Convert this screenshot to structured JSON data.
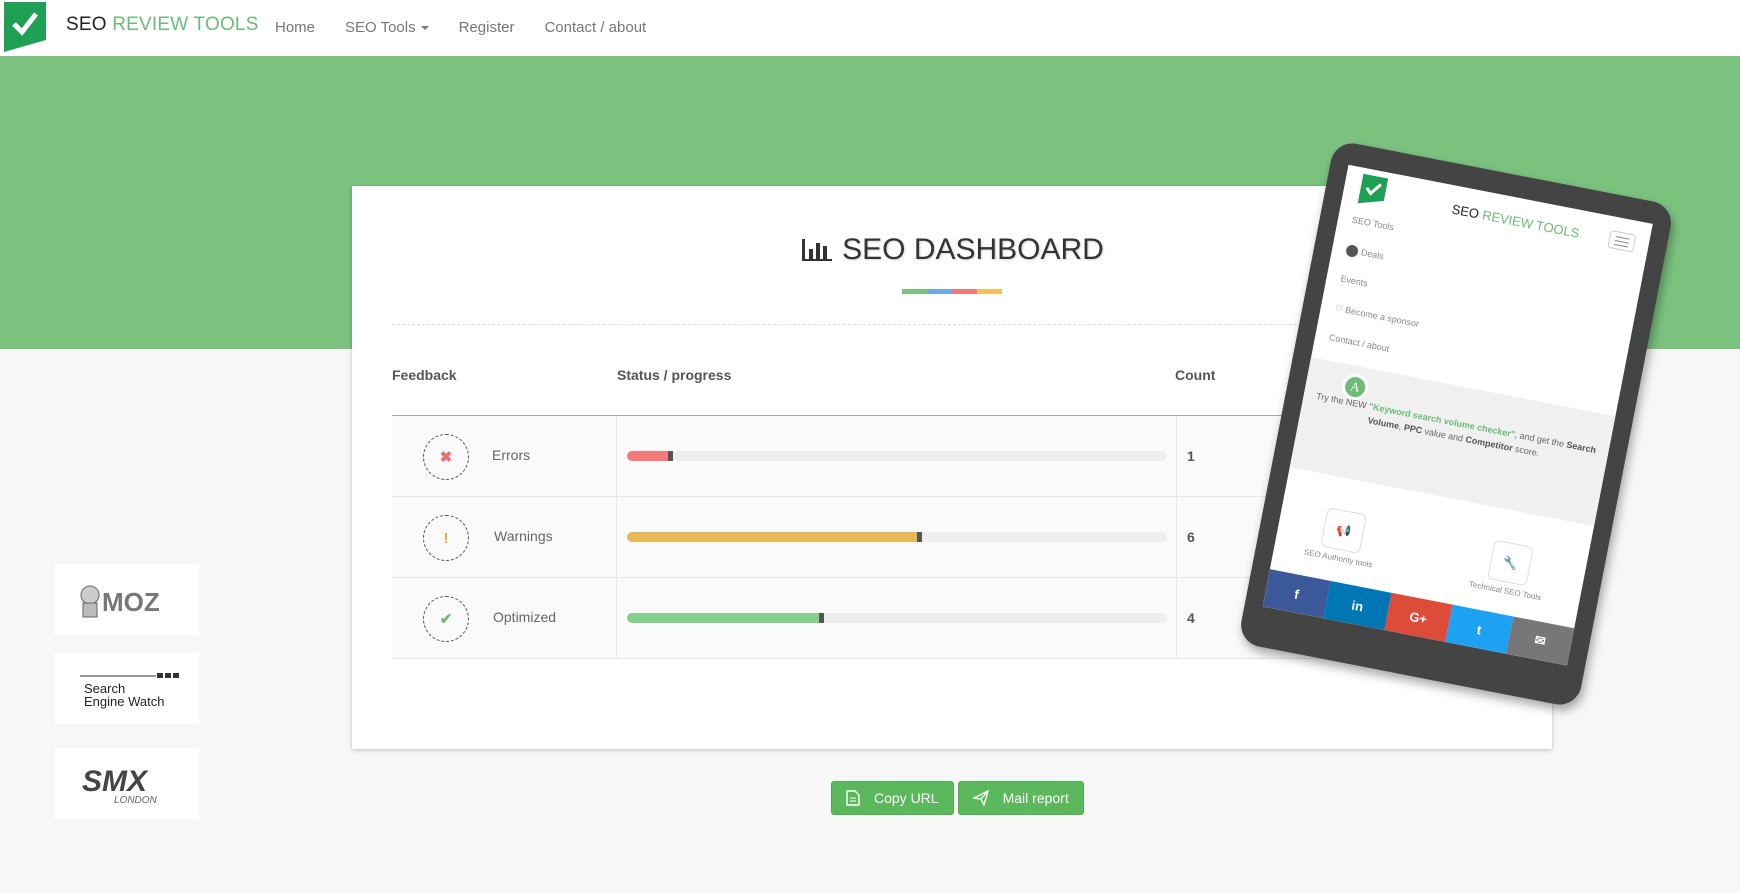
{
  "nav": {
    "brand_prefix": "SEO",
    "brand_accent": "REVIEW TOOLS",
    "links": [
      "Home",
      "SEO Tools",
      "Register",
      "Contact / about"
    ]
  },
  "dashboard": {
    "title": "SEO DASHBOARD",
    "headers": {
      "feedback": "Feedback",
      "status": "Status / progress",
      "count": "Count"
    },
    "rows": [
      {
        "label": "Errors",
        "count": "1",
        "progress": 0.08,
        "color": "#f47a7a",
        "icon_name": "x-icon",
        "icon_color": "#e9706f"
      },
      {
        "label": "Warnings",
        "count": "6",
        "progress": 0.54,
        "color": "#e8b95a",
        "icon_name": "exclamation-icon",
        "icon_color": "#e0aa3e"
      },
      {
        "label": "Optimized",
        "count": "4",
        "progress": 0.36,
        "color": "#85d08d",
        "icon_name": "check-icon",
        "icon_color": "#6cbb78"
      }
    ],
    "stripe_colors": [
      "#7bc27f",
      "#6fa8dc",
      "#f07a7a",
      "#f1c15e"
    ]
  },
  "buttons": {
    "copy_url": "Copy URL",
    "mail_report": "Mail report"
  },
  "sponsors": [
    "MOZ",
    "Search Engine Watch",
    "SMX LONDON"
  ],
  "phone": {
    "brand_prefix": "SEO",
    "brand_accent": "REVIEW TOOLS",
    "menu": [
      "SEO Tools",
      "Deals",
      "Events",
      "Become a sponsor",
      "Contact / about"
    ],
    "promo_intro": "Try the NEW",
    "promo_link": "\"Keyword search volume checker\"",
    "promo_rest1": ", and get the",
    "promo_bold1": "Search Volume",
    "promo_sep": ",",
    "promo_bold2": "PPC",
    "promo_rest2": "value and",
    "promo_bold3": "Competitor",
    "promo_rest3": "score.",
    "promo_badge": "A",
    "tool_left": "SEO Authority tools",
    "tool_right": "Technical SEO Tools",
    "share_icons": [
      "facebook-icon",
      "linkedin-icon",
      "google-plus-icon",
      "twitter-icon",
      "mail-icon"
    ],
    "share_colors": [
      "#3b5998",
      "#0077b5",
      "#dd4b39",
      "#1da1f2",
      "#777777"
    ],
    "share_glyphs": [
      "f",
      "in",
      "G+",
      "t",
      "✉"
    ]
  },
  "colors": {
    "hero": "#7bc27f",
    "accent": "#6cbb78",
    "button": "#5cb85c"
  }
}
